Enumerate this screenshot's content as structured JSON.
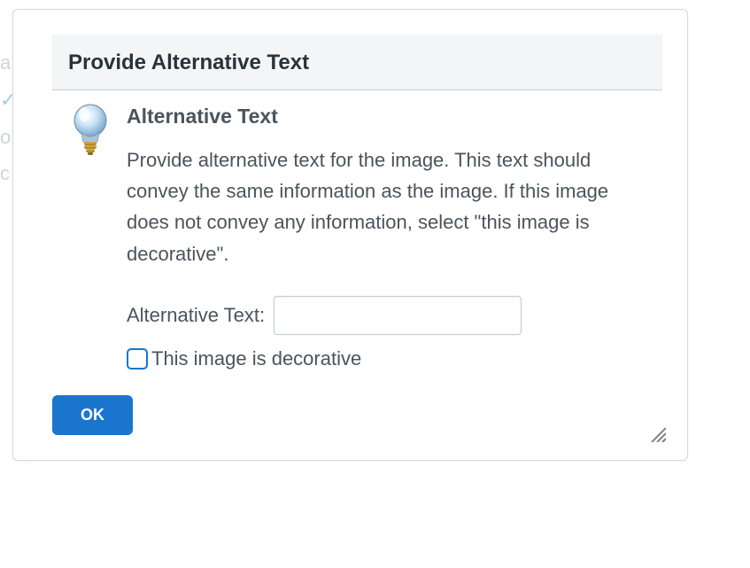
{
  "dialog": {
    "title": "Provide Alternative Text",
    "section_title": "Alternative Text",
    "description": "Provide alternative text for the image. This text should convey the same information as the image. If this image does not convey any information, select \"this image is decorative\".",
    "field_label": "Alternative Text:",
    "field_value": "",
    "checkbox_label": "This image is decorative",
    "checkbox_checked": false,
    "ok_label": "OK"
  },
  "icons": {
    "bulb": "lightbulb-icon",
    "resize": "resize-handle-icon"
  }
}
